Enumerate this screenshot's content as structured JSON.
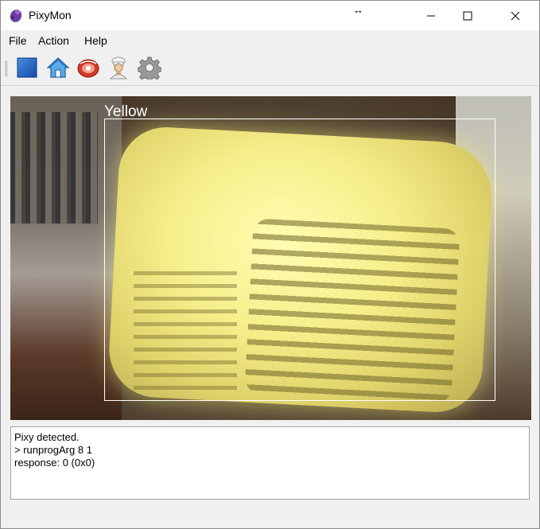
{
  "window": {
    "title": "PixyMon",
    "resize_cursor": "↔"
  },
  "menu": {
    "items": [
      {
        "label": "File"
      },
      {
        "label": "Action"
      },
      {
        "label": "Help"
      }
    ]
  },
  "toolbar": {
    "buttons": [
      {
        "icon": "run-square-icon",
        "color": "#1f66cc"
      },
      {
        "icon": "home-icon",
        "color": "#3a8fd8"
      },
      {
        "icon": "raw-video-icon",
        "color": "#d2382a"
      },
      {
        "icon": "chef-icon",
        "color": "#c7a070"
      },
      {
        "icon": "gear-icon",
        "color": "#8a8a8a"
      }
    ]
  },
  "video": {
    "detection_label": "Yellow"
  },
  "console": {
    "lines": [
      "Pixy detected.",
      "> runprogArg 8 1",
      "response: 0 (0x0)"
    ]
  }
}
